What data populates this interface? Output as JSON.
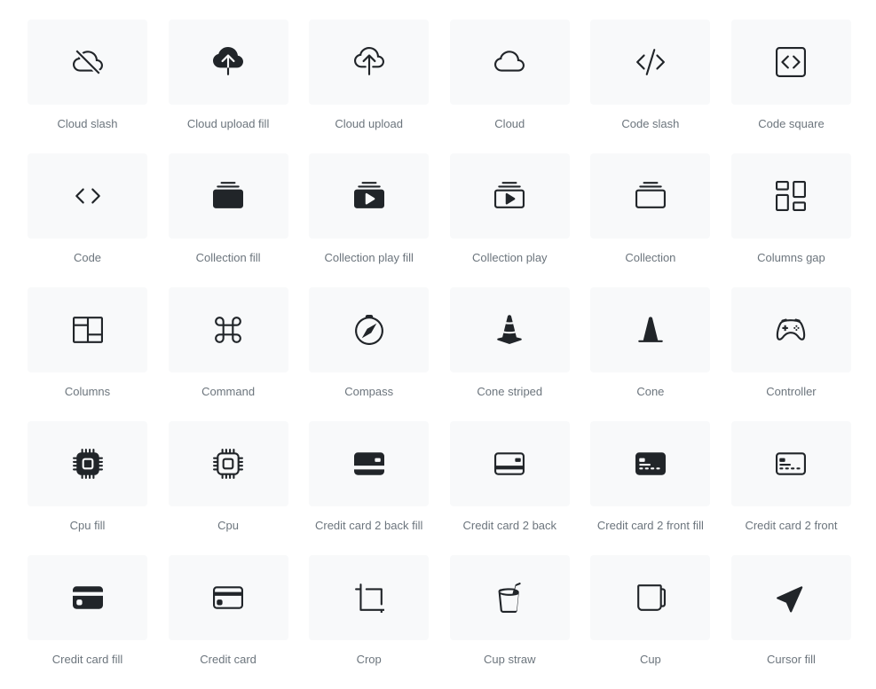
{
  "icons": [
    {
      "label": "Cloud slash",
      "icon": "cloud-slash-icon"
    },
    {
      "label": "Cloud upload fill",
      "icon": "cloud-upload-fill-icon"
    },
    {
      "label": "Cloud upload",
      "icon": "cloud-upload-icon"
    },
    {
      "label": "Cloud",
      "icon": "cloud-icon"
    },
    {
      "label": "Code slash",
      "icon": "code-slash-icon"
    },
    {
      "label": "Code square",
      "icon": "code-square-icon"
    },
    {
      "label": "Code",
      "icon": "code-icon"
    },
    {
      "label": "Collection fill",
      "icon": "collection-fill-icon"
    },
    {
      "label": "Collection play fill",
      "icon": "collection-play-fill-icon"
    },
    {
      "label": "Collection play",
      "icon": "collection-play-icon"
    },
    {
      "label": "Collection",
      "icon": "collection-icon"
    },
    {
      "label": "Columns gap",
      "icon": "columns-gap-icon"
    },
    {
      "label": "Columns",
      "icon": "columns-icon"
    },
    {
      "label": "Command",
      "icon": "command-icon"
    },
    {
      "label": "Compass",
      "icon": "compass-icon"
    },
    {
      "label": "Cone striped",
      "icon": "cone-striped-icon"
    },
    {
      "label": "Cone",
      "icon": "cone-icon"
    },
    {
      "label": "Controller",
      "icon": "controller-icon"
    },
    {
      "label": "Cpu fill",
      "icon": "cpu-fill-icon"
    },
    {
      "label": "Cpu",
      "icon": "cpu-icon"
    },
    {
      "label": "Credit card 2 back fill",
      "icon": "credit-card-2-back-fill-icon"
    },
    {
      "label": "Credit card 2 back",
      "icon": "credit-card-2-back-icon"
    },
    {
      "label": "Credit card 2 front fill",
      "icon": "credit-card-2-front-fill-icon"
    },
    {
      "label": "Credit card 2 front",
      "icon": "credit-card-2-front-icon"
    },
    {
      "label": "Credit card fill",
      "icon": "credit-card-fill-icon"
    },
    {
      "label": "Credit card",
      "icon": "credit-card-icon"
    },
    {
      "label": "Crop",
      "icon": "crop-icon"
    },
    {
      "label": "Cup straw",
      "icon": "cup-straw-icon"
    },
    {
      "label": "Cup",
      "icon": "cup-icon"
    },
    {
      "label": "Cursor fill",
      "icon": "cursor-fill-icon"
    }
  ],
  "colors": {
    "tile_bg": "#f8f9fa",
    "icon": "#212529",
    "label": "#6c757d"
  }
}
